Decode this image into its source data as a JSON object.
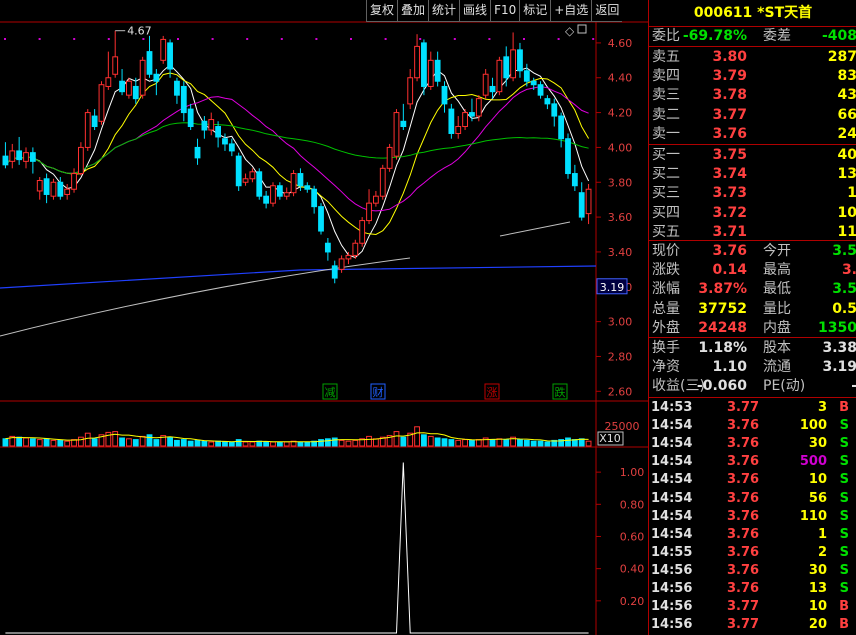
{
  "toolbar": {
    "items": [
      "复权",
      "叠加",
      "统计",
      "画线",
      "F10",
      "标记",
      "+自选",
      "返回"
    ]
  },
  "stock": {
    "code": "000611",
    "name": "*ST天首"
  },
  "order_book": {
    "ratio_label": "委比",
    "ratio_value": "-69.78%",
    "diff_label": "委差",
    "diff_value": "-408",
    "asks": [
      {
        "label": "卖五",
        "price": "3.80",
        "vol": "287"
      },
      {
        "label": "卖四",
        "price": "3.79",
        "vol": "83"
      },
      {
        "label": "卖三",
        "price": "3.78",
        "vol": "43"
      },
      {
        "label": "卖二",
        "price": "3.77",
        "vol": "66"
      },
      {
        "label": "卖一",
        "price": "3.76",
        "vol": "24"
      }
    ],
    "bids": [
      {
        "label": "买一",
        "price": "3.75",
        "vol": "40"
      },
      {
        "label": "买二",
        "price": "3.74",
        "vol": "13"
      },
      {
        "label": "买三",
        "price": "3.73",
        "vol": "1"
      },
      {
        "label": "买四",
        "price": "3.72",
        "vol": "10"
      },
      {
        "label": "买五",
        "price": "3.71",
        "vol": "11"
      }
    ]
  },
  "quote": [
    {
      "l1": "现价",
      "v1": "3.76",
      "c1": "red",
      "l2": "今开",
      "v2": "3.5",
      "c2": "green"
    },
    {
      "l1": "涨跌",
      "v1": "0.14",
      "c1": "red",
      "l2": "最高",
      "v2": "3.",
      "c2": "red"
    },
    {
      "l1": "涨幅",
      "v1": "3.87%",
      "c1": "red",
      "l2": "最低",
      "v2": "3.5",
      "c2": "green"
    },
    {
      "l1": "总量",
      "v1": "37752",
      "c1": "yellow",
      "l2": "量比",
      "v2": "0.5",
      "c2": "yellow"
    },
    {
      "l1": "外盘",
      "v1": "24248",
      "c1": "red",
      "l2": "内盘",
      "v2": "1350",
      "c2": "green"
    }
  ],
  "fundamentals": [
    {
      "l1": "换手",
      "v1": "1.18%",
      "l2": "股本",
      "v2": "3.38"
    },
    {
      "l1": "净资",
      "v1": "1.10",
      "l2": "流通",
      "v2": "3.19"
    },
    {
      "l1": "收益(三)",
      "v1": "-0.060",
      "l2": "PE(动)",
      "v2": "-"
    }
  ],
  "trades": [
    {
      "time": "14:53",
      "price": "3.77",
      "vol": "3",
      "side": "B"
    },
    {
      "time": "14:54",
      "price": "3.76",
      "vol": "100",
      "side": "S"
    },
    {
      "time": "14:54",
      "price": "3.76",
      "vol": "30",
      "side": "S"
    },
    {
      "time": "14:54",
      "price": "3.76",
      "vol": "500",
      "side": "S"
    },
    {
      "time": "14:54",
      "price": "3.76",
      "vol": "10",
      "side": "S"
    },
    {
      "time": "14:54",
      "price": "3.76",
      "vol": "56",
      "side": "S"
    },
    {
      "time": "14:54",
      "price": "3.76",
      "vol": "110",
      "side": "S"
    },
    {
      "time": "14:54",
      "price": "3.76",
      "vol": "1",
      "side": "S"
    },
    {
      "time": "14:55",
      "price": "3.76",
      "vol": "2",
      "side": "S"
    },
    {
      "time": "14:56",
      "price": "3.76",
      "vol": "30",
      "side": "S"
    },
    {
      "time": "14:56",
      "price": "3.76",
      "vol": "13",
      "side": "S"
    },
    {
      "time": "14:56",
      "price": "3.77",
      "vol": "10",
      "side": "B"
    },
    {
      "time": "14:56",
      "price": "3.77",
      "vol": "20",
      "side": "B"
    }
  ],
  "price_axis": {
    "ticks": [
      "4.60",
      "4.40",
      "4.20",
      "4.00",
      "3.80",
      "3.60",
      "3.40",
      "3.20",
      "3.00",
      "2.80",
      "2.60"
    ],
    "min": 2.55,
    "max": 4.72,
    "current_marker": "3.19"
  },
  "volume_axis": {
    "tick": "25000",
    "scale_label": "X10"
  },
  "indicator_axis": {
    "ticks": [
      "1.00",
      "0.80",
      "0.60",
      "0.40",
      "0.20"
    ]
  },
  "annotations": {
    "high_label": "4.67",
    "events": [
      "减",
      "财",
      "涨",
      "跌"
    ]
  },
  "chart_data": {
    "type": "candlestick",
    "candles": [
      [
        3.95,
        3.9,
        4.03,
        3.88
      ],
      [
        3.92,
        3.98,
        4.02,
        3.88
      ],
      [
        3.98,
        3.93,
        4.06,
        3.9
      ],
      [
        3.92,
        3.97,
        4.0,
        3.88
      ],
      [
        3.97,
        3.92,
        4.0,
        3.85
      ],
      [
        3.75,
        3.81,
        3.83,
        3.7
      ],
      [
        3.82,
        3.73,
        3.85,
        3.68
      ],
      [
        3.72,
        3.8,
        3.82,
        3.7
      ],
      [
        3.8,
        3.72,
        3.83,
        3.7
      ],
      [
        3.73,
        3.76,
        3.79,
        3.7
      ],
      [
        3.76,
        3.85,
        3.88,
        3.74
      ],
      [
        3.85,
        4.0,
        4.03,
        3.84
      ],
      [
        4.0,
        4.2,
        4.22,
        3.98
      ],
      [
        4.18,
        4.12,
        4.22,
        4.1
      ],
      [
        4.15,
        4.36,
        4.38,
        4.13
      ],
      [
        4.35,
        4.4,
        4.55,
        4.33
      ],
      [
        4.42,
        4.52,
        4.67,
        4.4
      ],
      [
        4.38,
        4.32,
        4.45,
        4.3
      ],
      [
        4.3,
        4.38,
        4.4,
        4.28
      ],
      [
        4.35,
        4.28,
        4.4,
        4.25
      ],
      [
        4.3,
        4.5,
        4.52,
        4.28
      ],
      [
        4.55,
        4.42,
        4.64,
        4.4
      ],
      [
        4.42,
        4.38,
        4.45,
        4.3
      ],
      [
        4.5,
        4.62,
        4.64,
        4.48
      ],
      [
        4.6,
        4.45,
        4.62,
        4.4
      ],
      [
        4.38,
        4.3,
        4.4,
        4.25
      ],
      [
        4.35,
        4.2,
        4.38,
        4.15
      ],
      [
        4.22,
        4.12,
        4.25,
        4.1
      ],
      [
        4.0,
        3.94,
        4.05,
        3.9
      ],
      [
        4.15,
        4.1,
        4.18,
        4.05
      ],
      [
        4.1,
        4.16,
        4.2,
        4.07
      ],
      [
        4.12,
        4.06,
        4.15,
        4.0
      ],
      [
        4.05,
        4.02,
        4.08,
        3.98
      ],
      [
        4.02,
        3.98,
        4.05,
        3.95
      ],
      [
        3.95,
        3.78,
        3.97,
        3.75
      ],
      [
        3.8,
        3.82,
        3.85,
        3.78
      ],
      [
        3.82,
        3.86,
        3.88,
        3.8
      ],
      [
        3.86,
        3.72,
        3.88,
        3.7
      ],
      [
        3.72,
        3.68,
        3.75,
        3.65
      ],
      [
        3.68,
        3.78,
        3.8,
        3.66
      ],
      [
        3.78,
        3.72,
        3.8,
        3.7
      ],
      [
        3.72,
        3.74,
        3.77,
        3.7
      ],
      [
        3.74,
        3.85,
        3.87,
        3.72
      ],
      [
        3.85,
        3.78,
        3.88,
        3.75
      ],
      [
        3.78,
        3.76,
        3.8,
        3.74
      ],
      [
        3.76,
        3.66,
        3.78,
        3.62
      ],
      [
        3.66,
        3.52,
        3.68,
        3.5
      ],
      [
        3.45,
        3.4,
        3.48,
        3.35
      ],
      [
        3.32,
        3.25,
        3.35,
        3.22
      ],
      [
        3.3,
        3.36,
        3.38,
        3.28
      ],
      [
        3.36,
        3.38,
        3.4,
        3.33
      ],
      [
        3.38,
        3.45,
        3.47,
        3.36
      ],
      [
        3.45,
        3.58,
        3.6,
        3.43
      ],
      [
        3.58,
        3.68,
        3.76,
        3.56
      ],
      [
        3.68,
        3.72,
        3.75,
        3.66
      ],
      [
        3.72,
        3.88,
        3.9,
        3.7
      ],
      [
        3.88,
        4.0,
        4.02,
        3.86
      ],
      [
        3.95,
        4.2,
        4.22,
        3.93
      ],
      [
        4.15,
        4.12,
        4.25,
        4.1
      ],
      [
        4.25,
        4.4,
        4.45,
        4.22
      ],
      [
        4.4,
        4.58,
        4.65,
        4.38
      ],
      [
        4.6,
        4.35,
        4.62,
        4.3
      ],
      [
        4.35,
        4.5,
        4.55,
        4.33
      ],
      [
        4.5,
        4.38,
        4.55,
        4.35
      ],
      [
        4.35,
        4.25,
        4.38,
        4.2
      ],
      [
        4.22,
        4.08,
        4.25,
        4.05
      ],
      [
        4.08,
        4.12,
        4.18,
        4.05
      ],
      [
        4.12,
        4.2,
        4.22,
        4.1
      ],
      [
        4.2,
        4.18,
        4.28,
        4.15
      ],
      [
        4.18,
        4.28,
        4.3,
        4.15
      ],
      [
        4.3,
        4.42,
        4.45,
        4.28
      ],
      [
        4.35,
        4.32,
        4.4,
        4.28
      ],
      [
        4.32,
        4.5,
        4.52,
        4.3
      ],
      [
        4.52,
        4.4,
        4.58,
        4.35
      ],
      [
        4.4,
        4.56,
        4.66,
        4.38
      ],
      [
        4.56,
        4.44,
        4.6,
        4.4
      ],
      [
        4.44,
        4.38,
        4.48,
        4.35
      ],
      [
        4.38,
        4.36,
        4.4,
        4.33
      ],
      [
        4.36,
        4.3,
        4.38,
        4.28
      ],
      [
        4.28,
        4.25,
        4.3,
        4.22
      ],
      [
        4.25,
        4.18,
        4.28,
        4.12
      ],
      [
        4.18,
        4.05,
        4.2,
        4.0
      ],
      [
        4.05,
        3.85,
        4.08,
        3.82
      ],
      [
        3.85,
        3.78,
        3.9,
        3.75
      ],
      [
        3.74,
        3.6,
        3.8,
        3.58
      ],
      [
        3.62,
        3.76,
        3.79,
        3.56
      ]
    ],
    "volume_max": 55000,
    "volumes": [
      9000,
      12000,
      11000,
      10000,
      9000,
      8000,
      9000,
      7000,
      7000,
      6000,
      8000,
      11000,
      16000,
      9000,
      14000,
      17000,
      18000,
      10000,
      9000,
      8000,
      12000,
      14000,
      8000,
      13000,
      11000,
      7000,
      8000,
      6000,
      7000,
      6000,
      5000,
      6000,
      5000,
      5000,
      8000,
      5000,
      5000,
      6000,
      5000,
      5000,
      5000,
      5000,
      6000,
      5000,
      5000,
      6000,
      8000,
      9000,
      10000,
      7000,
      6000,
      7000,
      9000,
      12000,
      9000,
      11000,
      13000,
      18000,
      11000,
      16000,
      24000,
      14000,
      12000,
      10000,
      9000,
      8000,
      7000,
      8000,
      7000,
      8000,
      10000,
      8000,
      9000,
      8000,
      11000,
      8000,
      7000,
      6000,
      6000,
      5000,
      7000,
      8000,
      10000,
      8000,
      9000,
      6000
    ],
    "indicator": {
      "ylim": [
        0,
        1.15
      ],
      "spike_index": 58,
      "spike_value": 1.06
    }
  }
}
